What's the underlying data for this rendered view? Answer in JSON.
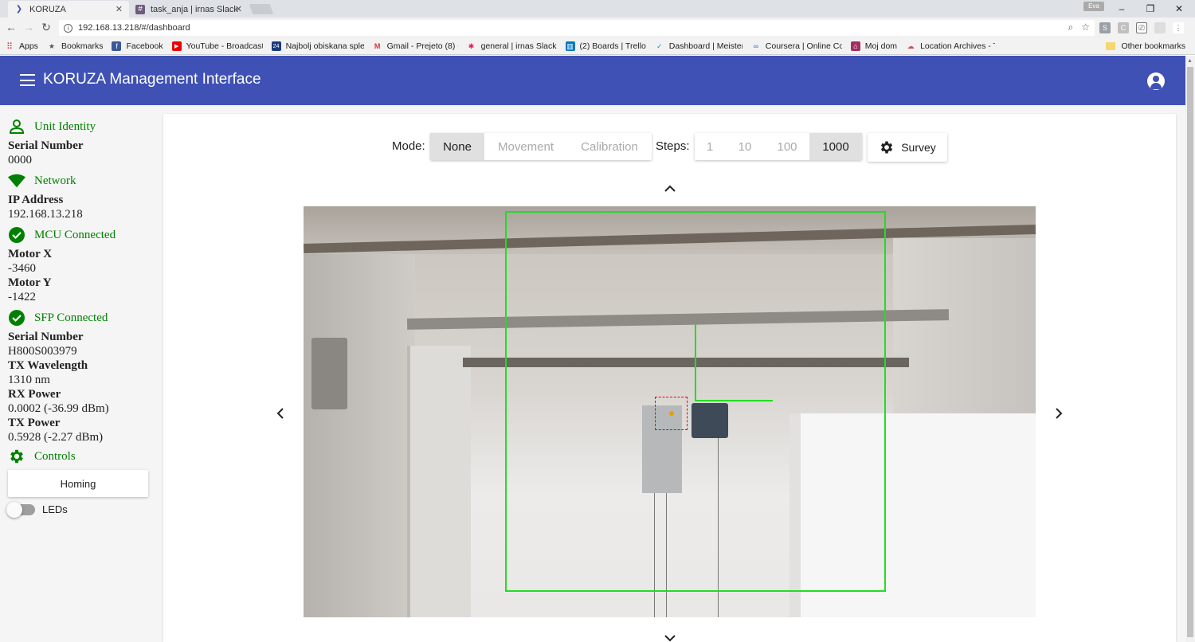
{
  "browser": {
    "tabs": [
      {
        "title": "KORUZA",
        "active": true
      },
      {
        "title": "task_anja | irnas Slack",
        "active": false
      }
    ],
    "user_chip": "Eva",
    "url": "192.168.13.218/#/dashboard",
    "bookmarks": [
      {
        "label": "Apps",
        "icon": "apps-grid-icon"
      },
      {
        "label": "Bookmarks",
        "icon": "star-icon"
      },
      {
        "label": "Facebook",
        "icon": "facebook-icon"
      },
      {
        "label": "YouTube - Broadcast",
        "icon": "youtube-icon"
      },
      {
        "label": "Najbolj obiskana sple",
        "icon": "24ur-icon"
      },
      {
        "label": "Gmail - Prejeto (8) - e",
        "icon": "gmail-icon"
      },
      {
        "label": "general | irnas Slack",
        "icon": "slack-icon"
      },
      {
        "label": "(2) Boards | Trello",
        "icon": "trello-icon"
      },
      {
        "label": "Dashboard | MeisterT",
        "icon": "meistertask-icon"
      },
      {
        "label": "Coursera | Online Cou",
        "icon": "coursera-icon"
      },
      {
        "label": "Moj dom",
        "icon": "mojdom-icon"
      },
      {
        "label": "Location Archives - T",
        "icon": "location-icon"
      }
    ],
    "other_bookmarks": "Other bookmarks"
  },
  "app": {
    "title": "KORUZA Management Interface",
    "accent": "#3f51b5",
    "status_color": "#008000"
  },
  "sidebar": {
    "unit_identity": {
      "heading": "Unit Identity",
      "serial_label": "Serial Number",
      "serial_value": "0000"
    },
    "network": {
      "heading": "Network",
      "ip_label": "IP Address",
      "ip_value": "192.168.13.218"
    },
    "mcu": {
      "heading": "MCU Connected",
      "motor_x_label": "Motor X",
      "motor_x_value": "-3460",
      "motor_y_label": "Motor Y",
      "motor_y_value": "-1422"
    },
    "sfp": {
      "heading": "SFP Connected",
      "serial_label": "Serial Number",
      "serial_value": "H800S003979",
      "tx_wavelength_label": "TX Wavelength",
      "tx_wavelength_value": "1310 nm",
      "rx_power_label": "RX Power",
      "rx_power_value": "0.0002 (-36.99 dBm)",
      "tx_power_label": "TX Power",
      "tx_power_value": "0.5928 (-2.27 dBm)"
    },
    "controls": {
      "heading": "Controls",
      "homing_label": "Homing",
      "leds_label": "LEDs",
      "leds_on": false
    }
  },
  "toolbar": {
    "mode_label": "Mode:",
    "modes": [
      "None",
      "Movement",
      "Calibration"
    ],
    "selected_mode": "None",
    "steps_label": "Steps:",
    "steps": [
      "1",
      "10",
      "100",
      "1000"
    ],
    "selected_step": "1000",
    "survey_label": "Survey"
  }
}
